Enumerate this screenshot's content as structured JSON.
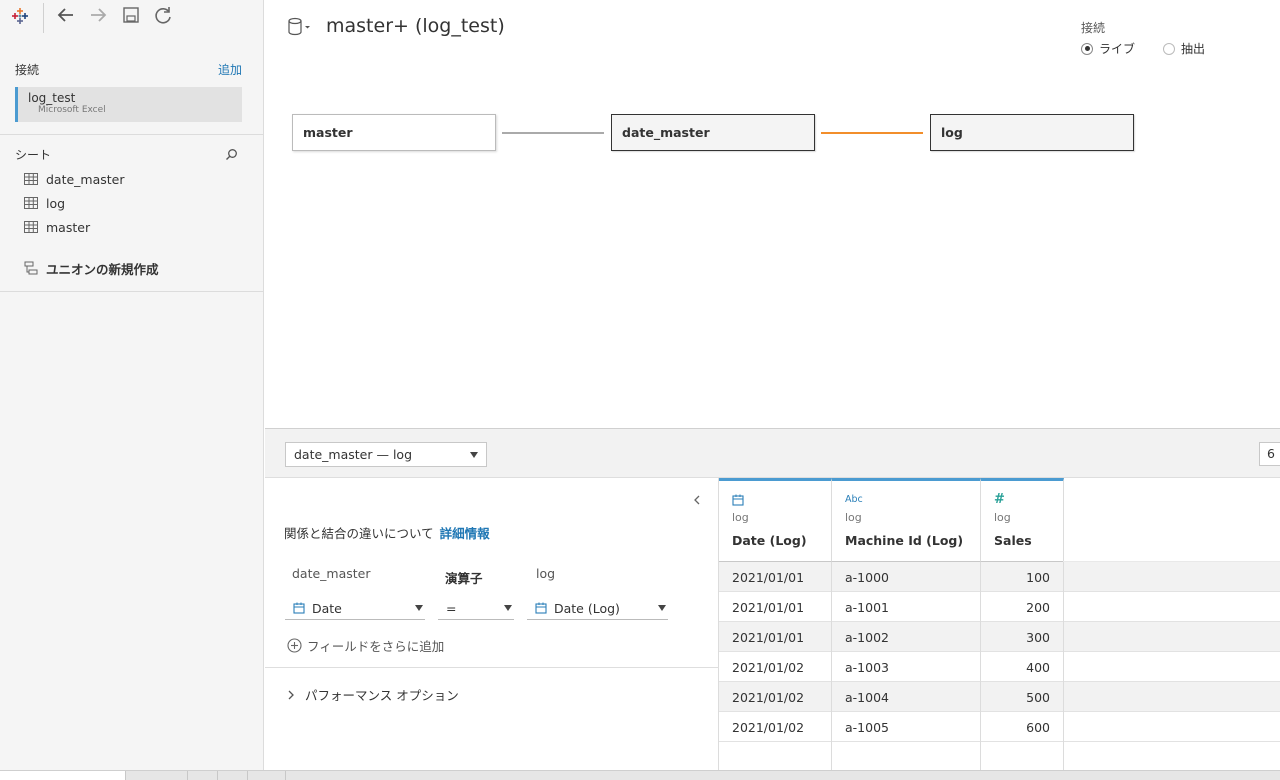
{
  "sidebar": {
    "connections_title": "接続",
    "add_label": "追加",
    "connection": {
      "name": "log_test",
      "type": "Microsoft Excel"
    },
    "sheets_title": "シート",
    "sheets": [
      {
        "label": "date_master"
      },
      {
        "label": "log"
      },
      {
        "label": "master"
      }
    ],
    "new_union": "ユニオンの新規作成"
  },
  "canvas": {
    "title": "master+ (log_test)",
    "connection_mode": {
      "label": "接続",
      "options": [
        {
          "label": "ライブ",
          "selected": true
        },
        {
          "label": "抽出",
          "selected": false
        }
      ]
    },
    "tables": [
      "master",
      "date_master",
      "log"
    ],
    "link_colors": [
      "#aaaaaa",
      "#f28e2b"
    ]
  },
  "relationship": {
    "selector": "date_master  —  log",
    "row_count": "6",
    "info_text": "関係と結合の違いについて",
    "info_link": "詳細情報",
    "left_table": "date_master",
    "operator_label": "演算子",
    "right_table": "log",
    "left_field": "Date",
    "operator": "=",
    "right_field": "Date (Log)",
    "add_field": "フィールドをさらに追加",
    "performance": "パフォーマンス オプション"
  },
  "grid": {
    "columns": [
      {
        "type_icon": "calendar-icon",
        "type_text": "",
        "source": "log",
        "name": "Date (Log)"
      },
      {
        "type_icon": "abc-icon",
        "type_text": "Abc",
        "source": "log",
        "name": "Machine Id (Log)"
      },
      {
        "type_icon": "number-icon",
        "type_text": "#",
        "source": "log",
        "name": "Sales"
      }
    ],
    "rows": [
      [
        "2021/01/01",
        "a-1000",
        "100"
      ],
      [
        "2021/01/01",
        "a-1001",
        "200"
      ],
      [
        "2021/01/01",
        "a-1002",
        "300"
      ],
      [
        "2021/01/02",
        "a-1003",
        "400"
      ],
      [
        "2021/01/02",
        "a-1004",
        "500"
      ],
      [
        "2021/01/02",
        "a-1005",
        "600"
      ]
    ]
  },
  "colors": {
    "accent": "#4b9bd1",
    "link": "#1f77b4",
    "orange_link": "#f28e2b",
    "type_green": "#2aa198"
  }
}
